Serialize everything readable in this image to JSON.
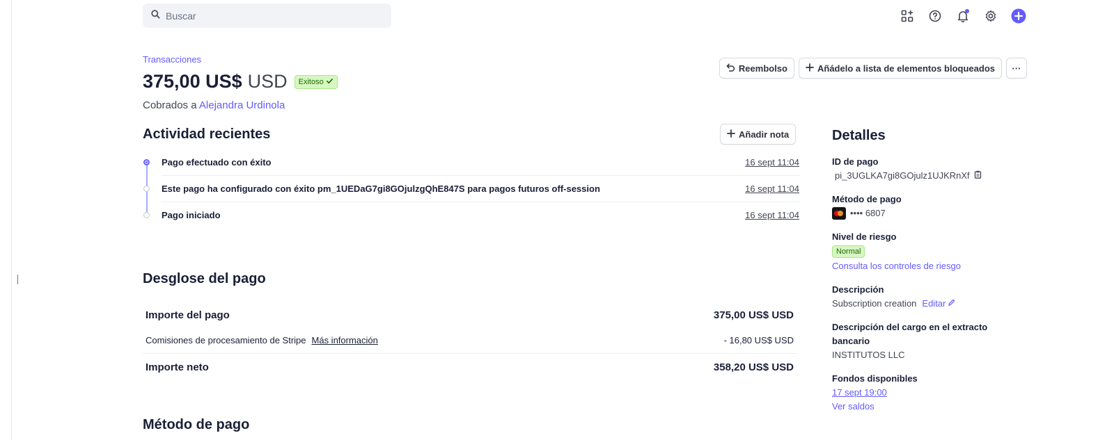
{
  "search": {
    "placeholder": "Buscar"
  },
  "header": {
    "breadcrumb": "Transacciones",
    "amount": "375,00 US$",
    "currency": "USD",
    "status": "Exitoso",
    "charged_prefix": "Cobrados a",
    "customer": "Alejandra Urdinola",
    "refund_label": "Reembolso",
    "blocklist_label": "Añádelo a lista de elementos bloqueados",
    "more_label": "···"
  },
  "activity": {
    "title": "Actividad recientes",
    "add_note_label": "Añadir nota",
    "items": [
      {
        "text": "Pago efectuado con éxito",
        "date": "16 sept 11:04"
      },
      {
        "text": "Este pago ha configurado con éxito pm_1UEDaG7gi8GOjulzgQhE847S para pagos futuros off-session",
        "date": "16 sept 11:04"
      },
      {
        "text": "Pago iniciado",
        "date": "16 sept 11:04"
      }
    ]
  },
  "breakdown": {
    "title": "Desglose del pago",
    "rows": [
      {
        "label": "Importe del pago",
        "value": "375,00 US$ USD"
      },
      {
        "label": "Comisiones de procesamiento de Stripe",
        "link": "Más información",
        "value": "- 16,80 US$ USD"
      },
      {
        "label": "Importe neto",
        "value": "358,20 US$ USD"
      }
    ]
  },
  "payment_method_section": {
    "title": "Método de pago"
  },
  "details": {
    "title": "Detalles",
    "payment_id_label": "ID de pago",
    "payment_id": "pi_3UGLKA7gi8GOjulz1UJKRnXf",
    "method_label": "Método de pago",
    "card_last4": "•••• 6807",
    "risk_label": "Nivel de riesgo",
    "risk_value": "Normal",
    "risk_link": "Consulta los controles de riesgo",
    "description_label": "Descripción",
    "description_value": "Subscription creation",
    "edit_label": "Editar",
    "statement_label": "Descripción del cargo en el extracto bancario",
    "statement_value": "INSTITUTOS LLC",
    "funds_label": "Fondos disponibles",
    "funds_date": "17 sept 19:00",
    "balances_link": "Ver saldos"
  },
  "colors": {
    "accent": "#635bff",
    "success_bg": "#d7f7c2",
    "success_text": "#1d6b00"
  },
  "icons": [
    "search-icon",
    "apps-icon",
    "help-icon",
    "notifications-icon",
    "settings-icon",
    "create-icon",
    "undo-icon",
    "plus-icon",
    "check-icon",
    "copy-icon",
    "pencil-icon",
    "mastercard-icon"
  ]
}
